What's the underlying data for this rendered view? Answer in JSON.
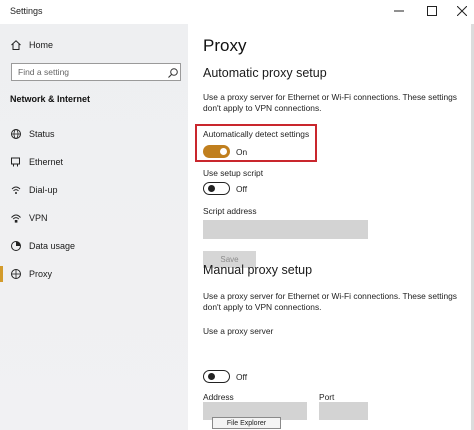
{
  "window": {
    "title": "Settings",
    "controls": {
      "minimize": "—",
      "maximize": "☐",
      "close": "✕"
    }
  },
  "sidebar": {
    "home_label": "Home",
    "search_placeholder": "Find a setting",
    "section_title": "Network & Internet",
    "items": [
      {
        "label": "Status",
        "icon": "globe-icon"
      },
      {
        "label": "Ethernet",
        "icon": "ethernet-icon"
      },
      {
        "label": "Dial-up",
        "icon": "dial-up-icon"
      },
      {
        "label": "VPN",
        "icon": "vpn-icon"
      },
      {
        "label": "Data usage",
        "icon": "data-usage-icon"
      },
      {
        "label": "Proxy",
        "icon": "proxy-icon"
      }
    ],
    "active_item": "Proxy"
  },
  "main": {
    "title": "Proxy",
    "automatic": {
      "heading": "Automatic proxy setup",
      "description": "Use a proxy server for Ethernet or Wi-Fi connections. These settings don't apply to VPN connections.",
      "detect_label": "Automatically detect settings",
      "detect_state": "On",
      "script_label": "Use setup script",
      "script_state": "Off",
      "address_label": "Script address",
      "address_value": "",
      "save_label": "Save"
    },
    "manual": {
      "heading": "Manual proxy setup",
      "description": "Use a proxy server for Ethernet or Wi-Fi connections. These settings don't apply to VPN connections.",
      "proxy_label": "Use a proxy server",
      "proxy_state": "Off",
      "address_label": "Address",
      "address_value": "",
      "port_label": "Port",
      "port_value": ""
    }
  },
  "tooltip": "File Explorer",
  "colors": {
    "accent": "#c07f1e",
    "active_indicator": "#d39b2b",
    "highlight_border": "#c9262d",
    "sidebar_bg": "#f0f0f2"
  }
}
